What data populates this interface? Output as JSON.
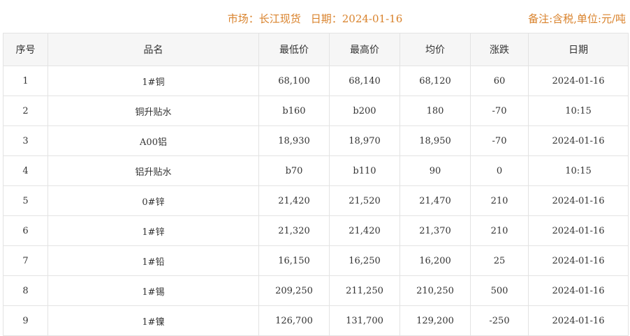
{
  "header": {
    "market_label": "市场：长江现货",
    "date_label": "日期：2024-01-16",
    "note": "备注:含税,单位:元/吨"
  },
  "table": {
    "columns": [
      "序号",
      "品名",
      "最低价",
      "最高价",
      "均价",
      "涨跌",
      "日期"
    ],
    "rows": [
      {
        "idx": "1",
        "name": "1#铜",
        "low": "68,100",
        "high": "68,140",
        "avg": "68,120",
        "change": "60",
        "trend": "up",
        "date": "2024-01-16"
      },
      {
        "idx": "2",
        "name": "铜升贴水",
        "low": "b160",
        "high": "b200",
        "avg": "180",
        "change": "-70",
        "trend": "down",
        "date": "10:15"
      },
      {
        "idx": "3",
        "name": "A00铝",
        "low": "18,930",
        "high": "18,970",
        "avg": "18,950",
        "change": "-70",
        "trend": "down",
        "date": "2024-01-16"
      },
      {
        "idx": "4",
        "name": "铝升贴水",
        "low": "b70",
        "high": "b110",
        "avg": "90",
        "change": "0",
        "trend": "flat",
        "date": "10:15"
      },
      {
        "idx": "5",
        "name": "0#锌",
        "low": "21,420",
        "high": "21,520",
        "avg": "21,470",
        "change": "210",
        "trend": "up",
        "date": "2024-01-16"
      },
      {
        "idx": "6",
        "name": "1#锌",
        "low": "21,320",
        "high": "21,420",
        "avg": "21,370",
        "change": "210",
        "trend": "up",
        "date": "2024-01-16"
      },
      {
        "idx": "7",
        "name": "1#铅",
        "low": "16,150",
        "high": "16,250",
        "avg": "16,200",
        "change": "25",
        "trend": "up",
        "date": "2024-01-16"
      },
      {
        "idx": "8",
        "name": "1#锡",
        "low": "209,250",
        "high": "211,250",
        "avg": "210,250",
        "change": "500",
        "trend": "up",
        "date": "2024-01-16"
      },
      {
        "idx": "9",
        "name": "1#镍",
        "low": "126,700",
        "high": "131,700",
        "avg": "129,200",
        "change": "-250",
        "trend": "down",
        "date": "2024-01-16"
      }
    ]
  },
  "colors": {
    "accent": "#d9822b",
    "up": "#d40000",
    "down": "#1a8a1a",
    "flat": "#b3b3b3",
    "header_bg": "#f6f6f6",
    "border": "#e3e3e3"
  }
}
